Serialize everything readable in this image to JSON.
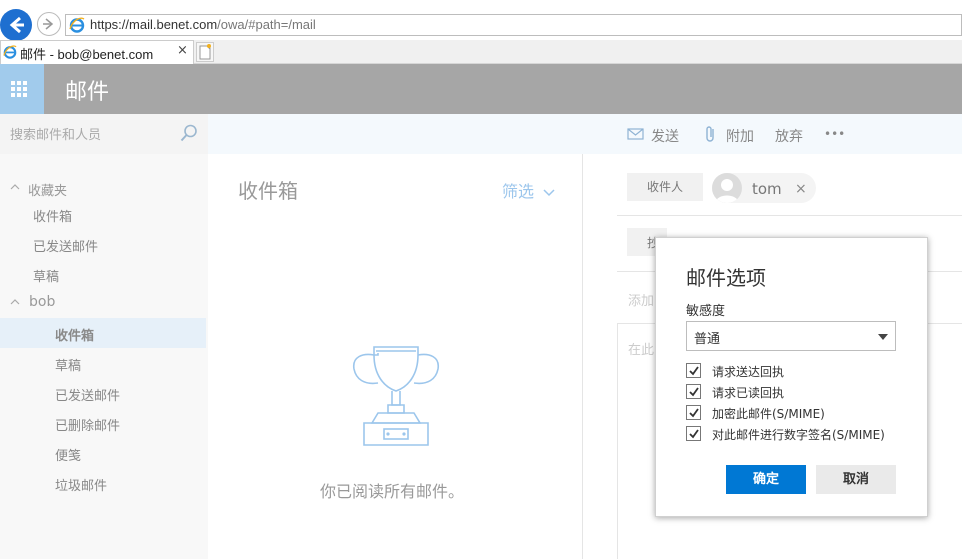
{
  "browser": {
    "address_main": "https://mail.benet.com",
    "address_path": "/owa/#path=/mail",
    "tab_title": "邮件 - bob@benet.com",
    "tab_close": "×"
  },
  "header": {
    "app_name": "邮件"
  },
  "search": {
    "placeholder": "搜索邮件和人员"
  },
  "command_bar": {
    "send": "发送",
    "attach": "附加",
    "discard": "放弃",
    "more": "•••"
  },
  "folders": {
    "favorites_label": "收藏夹",
    "favorites": [
      "收件箱",
      "已发送邮件",
      "草稿"
    ],
    "account_label": "bob",
    "account_folders": [
      "收件箱",
      "草稿",
      "已发送邮件",
      "已删除邮件",
      "便笺",
      "垃圾邮件"
    ],
    "selected": "收件箱"
  },
  "message_list": {
    "title": "收件箱",
    "filter_label": "筛选",
    "empty_message": "你已阅读所有邮件。"
  },
  "compose": {
    "to_label": "收件人",
    "recipient": "tom",
    "remove": "×",
    "cc_stub": "抄",
    "subject_stub": "添加",
    "body_stub": "在此"
  },
  "dialog": {
    "title": "邮件选项",
    "sensitivity_label": "敏感度",
    "sensitivity_value": "普通",
    "options": [
      {
        "label": "请求送达回执",
        "checked": true
      },
      {
        "label": "请求已读回执",
        "checked": true
      },
      {
        "label": "加密此邮件(S/MIME)",
        "checked": true
      },
      {
        "label": "对此邮件进行数字签名(S/MIME)",
        "checked": true
      }
    ],
    "ok": "确定",
    "cancel": "取消"
  },
  "colors": {
    "accent": "#0078d4",
    "header_bg": "#a6a6a6",
    "launcher_bg": "#a1cbec",
    "selected_folder_bg": "#e6f0f9",
    "filter_text": "#9cc6ec"
  }
}
